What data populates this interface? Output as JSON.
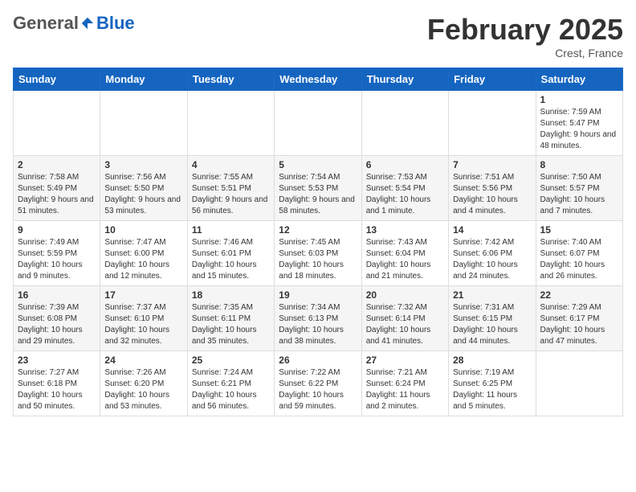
{
  "header": {
    "logo_general": "General",
    "logo_blue": "Blue",
    "month_year": "February 2025",
    "location": "Crest, France"
  },
  "days_of_week": [
    "Sunday",
    "Monday",
    "Tuesday",
    "Wednesday",
    "Thursday",
    "Friday",
    "Saturday"
  ],
  "weeks": [
    [
      {
        "day": "",
        "info": ""
      },
      {
        "day": "",
        "info": ""
      },
      {
        "day": "",
        "info": ""
      },
      {
        "day": "",
        "info": ""
      },
      {
        "day": "",
        "info": ""
      },
      {
        "day": "",
        "info": ""
      },
      {
        "day": "1",
        "info": "Sunrise: 7:59 AM\nSunset: 5:47 PM\nDaylight: 9 hours and 48 minutes."
      }
    ],
    [
      {
        "day": "2",
        "info": "Sunrise: 7:58 AM\nSunset: 5:49 PM\nDaylight: 9 hours and 51 minutes."
      },
      {
        "day": "3",
        "info": "Sunrise: 7:56 AM\nSunset: 5:50 PM\nDaylight: 9 hours and 53 minutes."
      },
      {
        "day": "4",
        "info": "Sunrise: 7:55 AM\nSunset: 5:51 PM\nDaylight: 9 hours and 56 minutes."
      },
      {
        "day": "5",
        "info": "Sunrise: 7:54 AM\nSunset: 5:53 PM\nDaylight: 9 hours and 58 minutes."
      },
      {
        "day": "6",
        "info": "Sunrise: 7:53 AM\nSunset: 5:54 PM\nDaylight: 10 hours and 1 minute."
      },
      {
        "day": "7",
        "info": "Sunrise: 7:51 AM\nSunset: 5:56 PM\nDaylight: 10 hours and 4 minutes."
      },
      {
        "day": "8",
        "info": "Sunrise: 7:50 AM\nSunset: 5:57 PM\nDaylight: 10 hours and 7 minutes."
      }
    ],
    [
      {
        "day": "9",
        "info": "Sunrise: 7:49 AM\nSunset: 5:59 PM\nDaylight: 10 hours and 9 minutes."
      },
      {
        "day": "10",
        "info": "Sunrise: 7:47 AM\nSunset: 6:00 PM\nDaylight: 10 hours and 12 minutes."
      },
      {
        "day": "11",
        "info": "Sunrise: 7:46 AM\nSunset: 6:01 PM\nDaylight: 10 hours and 15 minutes."
      },
      {
        "day": "12",
        "info": "Sunrise: 7:45 AM\nSunset: 6:03 PM\nDaylight: 10 hours and 18 minutes."
      },
      {
        "day": "13",
        "info": "Sunrise: 7:43 AM\nSunset: 6:04 PM\nDaylight: 10 hours and 21 minutes."
      },
      {
        "day": "14",
        "info": "Sunrise: 7:42 AM\nSunset: 6:06 PM\nDaylight: 10 hours and 24 minutes."
      },
      {
        "day": "15",
        "info": "Sunrise: 7:40 AM\nSunset: 6:07 PM\nDaylight: 10 hours and 26 minutes."
      }
    ],
    [
      {
        "day": "16",
        "info": "Sunrise: 7:39 AM\nSunset: 6:08 PM\nDaylight: 10 hours and 29 minutes."
      },
      {
        "day": "17",
        "info": "Sunrise: 7:37 AM\nSunset: 6:10 PM\nDaylight: 10 hours and 32 minutes."
      },
      {
        "day": "18",
        "info": "Sunrise: 7:35 AM\nSunset: 6:11 PM\nDaylight: 10 hours and 35 minutes."
      },
      {
        "day": "19",
        "info": "Sunrise: 7:34 AM\nSunset: 6:13 PM\nDaylight: 10 hours and 38 minutes."
      },
      {
        "day": "20",
        "info": "Sunrise: 7:32 AM\nSunset: 6:14 PM\nDaylight: 10 hours and 41 minutes."
      },
      {
        "day": "21",
        "info": "Sunrise: 7:31 AM\nSunset: 6:15 PM\nDaylight: 10 hours and 44 minutes."
      },
      {
        "day": "22",
        "info": "Sunrise: 7:29 AM\nSunset: 6:17 PM\nDaylight: 10 hours and 47 minutes."
      }
    ],
    [
      {
        "day": "23",
        "info": "Sunrise: 7:27 AM\nSunset: 6:18 PM\nDaylight: 10 hours and 50 minutes."
      },
      {
        "day": "24",
        "info": "Sunrise: 7:26 AM\nSunset: 6:20 PM\nDaylight: 10 hours and 53 minutes."
      },
      {
        "day": "25",
        "info": "Sunrise: 7:24 AM\nSunset: 6:21 PM\nDaylight: 10 hours and 56 minutes."
      },
      {
        "day": "26",
        "info": "Sunrise: 7:22 AM\nSunset: 6:22 PM\nDaylight: 10 hours and 59 minutes."
      },
      {
        "day": "27",
        "info": "Sunrise: 7:21 AM\nSunset: 6:24 PM\nDaylight: 11 hours and 2 minutes."
      },
      {
        "day": "28",
        "info": "Sunrise: 7:19 AM\nSunset: 6:25 PM\nDaylight: 11 hours and 5 minutes."
      },
      {
        "day": "",
        "info": ""
      }
    ]
  ]
}
